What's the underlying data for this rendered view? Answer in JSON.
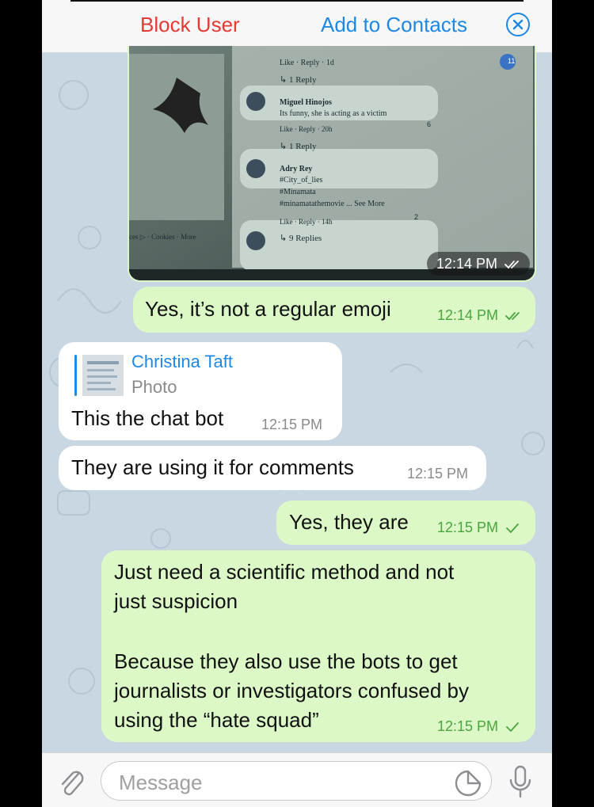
{
  "header": {
    "block_label": "Block User",
    "add_label": "Add to Contacts",
    "close_icon": "close-circle-icon",
    "block_color": "#e53935",
    "add_color": "#1e88e5"
  },
  "photo_message": {
    "time": "12:14 PM",
    "status_icon": "double-check-icon",
    "embedded_screenshot": {
      "comments": [
        {
          "meta": "Like · Reply · 1d",
          "replies": "↳ 1 Reply",
          "reaction_count": "11"
        },
        {
          "author": "Miguel Hinojos",
          "text": "Its funny, she is acting as a victim",
          "meta": "Like · Reply · 20h",
          "replies": "↳ 1 Reply",
          "reaction_count": "6"
        },
        {
          "author": "Adry Rey",
          "lines": [
            "#City_of_lies",
            "#Minamata",
            "#minamatathemovie ... See More"
          ],
          "meta": "Like · Reply · 14h",
          "replies": "↳ 9 Replies",
          "reaction_count": "2"
        }
      ],
      "footer_links": "ces ▷ · Cookies · More"
    }
  },
  "messages": [
    {
      "direction": "out",
      "text": "Yes, it’s not a regular emoji",
      "time": "12:14 PM",
      "status_icon": "double-check-icon"
    },
    {
      "direction": "in",
      "reply_to": {
        "name": "Christina Taft",
        "type": "Photo"
      },
      "text": "This the chat bot",
      "time": "12:15 PM"
    },
    {
      "direction": "in",
      "text": "They are using it for comments",
      "time": "12:15 PM"
    },
    {
      "direction": "out",
      "text": "Yes, they are",
      "time": "12:15 PM",
      "status_icon": "single-check-icon"
    },
    {
      "direction": "out",
      "lines": [
        "Just need a scientific method and not",
        "just suspicion",
        "",
        "Because they also use the bots to get",
        "journalists or investigators confused by",
        "using the “hate squad”"
      ],
      "time": "12:15 PM",
      "status_icon": "single-check-icon"
    }
  ],
  "composer": {
    "placeholder": "Message",
    "attach_icon": "paperclip-icon",
    "sticker_icon": "sticker-icon",
    "mic_icon": "microphone-icon"
  },
  "colors": {
    "outgoing_bubble": "#dcf8c6",
    "incoming_bubble": "#ffffff",
    "wallpaper": "#c9d7e2",
    "time_outgoing": "#4aa43f",
    "link_blue": "#1e88e5"
  }
}
